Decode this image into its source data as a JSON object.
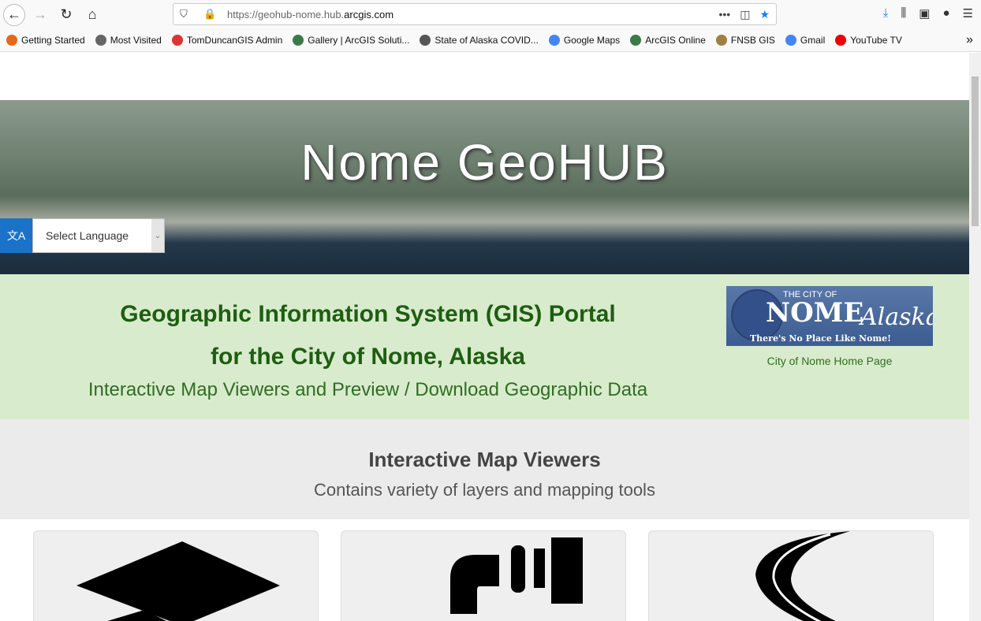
{
  "browser": {
    "url_prefix": "https://geohub-nome.hub.",
    "url_domain": "arcgis.com",
    "bookmarks": [
      {
        "label": "Getting Started",
        "color": "#e8661d"
      },
      {
        "label": "Most Visited",
        "color": "#666"
      },
      {
        "label": "TomDuncanGIS Admin",
        "color": "#d33"
      },
      {
        "label": "Gallery | ArcGIS Soluti...",
        "color": "#3a7a4a"
      },
      {
        "label": "State of Alaska COVID...",
        "color": "#555"
      },
      {
        "label": "Google Maps",
        "color": "#4285f4"
      },
      {
        "label": "ArcGIS Online",
        "color": "#3a7a4a"
      },
      {
        "label": "FNSB GIS",
        "color": "#a08040"
      },
      {
        "label": "Gmail",
        "color": "#4285f4"
      },
      {
        "label": "YouTube TV",
        "color": "#e00"
      }
    ]
  },
  "hero": {
    "title": "Nome GeoHUB",
    "language_select": "Select Language"
  },
  "intro": {
    "line1": "Geographic Information System (GIS) Portal",
    "line2": "for the City of Nome, Alaska",
    "line3": "Interactive Map Viewers and Preview / Download Geographic Data",
    "logo": {
      "the_city_of": "THE CITY OF",
      "nome": "NOME",
      "alaska": "Alaska",
      "tagline": "There's No Place Like Nome!"
    },
    "home_link": "City of Nome Home Page"
  },
  "viewers": {
    "title": "Interactive Map Viewers",
    "subtitle": "Contains variety of layers and mapping tools"
  }
}
